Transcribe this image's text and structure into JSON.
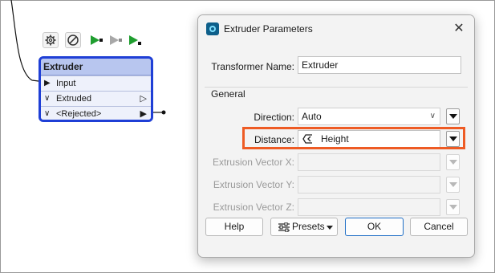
{
  "canvas": {
    "toolbar_icons": [
      "gear-icon",
      "disable-icon",
      "run-to-this-icon",
      "run-from-this-icon",
      "run-just-this-icon"
    ],
    "transformer": {
      "name": "Extruder",
      "input_port": "Input",
      "output_ports": [
        "Extruded",
        "<Rejected>"
      ]
    }
  },
  "dialog": {
    "title": "Extruder Parameters",
    "transformer_name_label": "Transformer Name:",
    "transformer_name_value": "Extruder",
    "group_label": "General",
    "direction_label": "Direction:",
    "direction_value": "Auto",
    "distance_label": "Distance:",
    "distance_value": "Height",
    "vector_x_label": "Extrusion Vector X:",
    "vector_y_label": "Extrusion Vector Y:",
    "vector_z_label": "Extrusion Vector Z:",
    "buttons": {
      "help": "Help",
      "presets": "Presets",
      "ok": "OK",
      "cancel": "Cancel"
    }
  },
  "colors": {
    "node_border": "#1f3fd6",
    "node_fill": "#dfe5f7",
    "highlight": "#ee5b24",
    "ok_border": "#1f6ec6",
    "run_green": "#1f9e2f"
  }
}
